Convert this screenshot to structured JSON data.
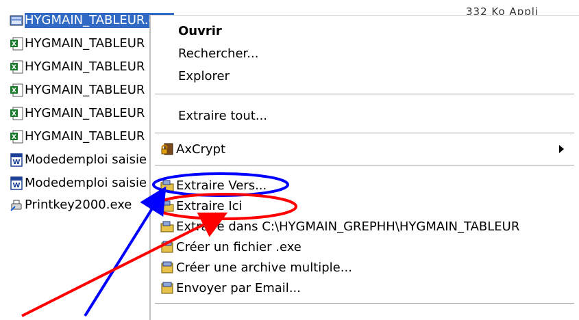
{
  "file_list": {
    "items": [
      {
        "name": "HYGMAIN_TABLEUR.exe",
        "icon": "winrar-sfx-icon",
        "selected": true
      },
      {
        "name": "HYGMAIN_TABLEUR",
        "icon": "excel-file-icon"
      },
      {
        "name": "HYGMAIN_TABLEUR",
        "icon": "excel-file-icon"
      },
      {
        "name": "HYGMAIN_TABLEUR",
        "icon": "excel-file-icon"
      },
      {
        "name": "HYGMAIN_TABLEUR",
        "icon": "excel-file-icon"
      },
      {
        "name": "HYGMAIN_TABLEUR",
        "icon": "excel-file-icon"
      },
      {
        "name": "Modedemploi saisie",
        "icon": "word-doc-icon"
      },
      {
        "name": "Modedemploi saisie",
        "icon": "word-doc-icon"
      },
      {
        "name": "Printkey2000.exe",
        "icon": "printkey-app-icon"
      }
    ],
    "top_right_text": "332 Ko  Appli"
  },
  "context_menu": {
    "open": "Ouvrir",
    "search": "Rechercher...",
    "explore": "Explorer",
    "extract_all": "Extraire tout...",
    "axcrypt": "AxCrypt",
    "extract_to": "Extraire Vers...",
    "extract_here": "Extraire Ici",
    "extract_into": "Extraire dans C:\\HYGMAIN_GREPHH\\HYGMAIN_TABLEUR",
    "create_exe": "Créer un fichier .exe",
    "create_multi": "Créer une archive multiple...",
    "send_email": "Envoyer par Email..."
  },
  "colors": {
    "selection": "#316ac5",
    "annotation_blue": "#0000ff",
    "annotation_red": "#ff0000"
  }
}
